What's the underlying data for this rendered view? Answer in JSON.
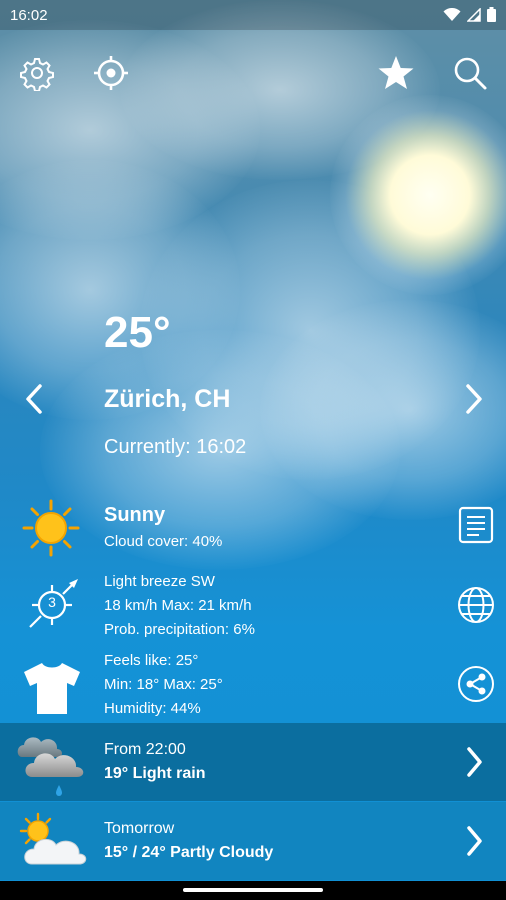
{
  "status_bar": {
    "time": "16:02"
  },
  "toolbar": {
    "settings_icon": "gear-icon",
    "locate_icon": "crosshair-icon",
    "favorite_icon": "star-icon",
    "search_icon": "search-icon"
  },
  "current": {
    "temperature": "25°",
    "location": "Zürich, CH",
    "currently": "Currently: 16:02"
  },
  "conditions": {
    "summary": "Sunny",
    "cloud_cover": "Cloud cover: 40%"
  },
  "wind": {
    "badge": "3",
    "description": "Light breeze SW",
    "speed": "18 km/h Max: 21 km/h",
    "precipitation": "Prob. precipitation: 6%"
  },
  "feels": {
    "feels_like": "Feels like: 25°",
    "min_max": "Min: 18° Max: 25°",
    "humidity": "Humidity: 44%"
  },
  "forecast": [
    {
      "line1": "From 22:00",
      "line2": "19° Light rain",
      "icon": "rain-cloud-icon"
    },
    {
      "line1": "Tomorrow",
      "line2": "15° / 24° Partly Cloudy",
      "icon": "partly-cloudy-icon"
    }
  ],
  "colors": {
    "sun": "#ffc21a",
    "forecast_row_1": "#0b6e9f",
    "forecast_row_2": "#1185c0"
  }
}
